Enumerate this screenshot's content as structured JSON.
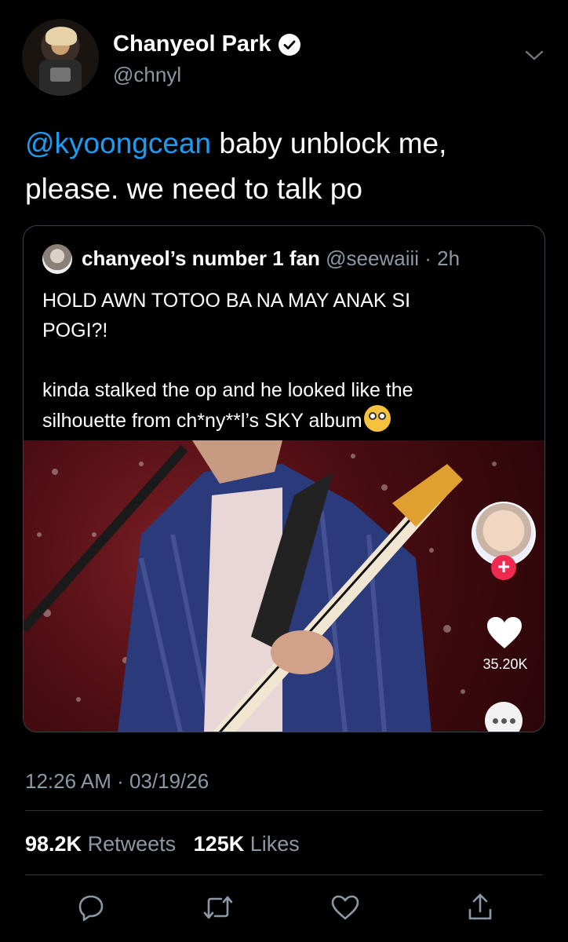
{
  "author": {
    "name": "Chanyeol Park",
    "handle": "@chnyl",
    "verified": true
  },
  "tweet": {
    "mention": "@kyoongcean",
    "text_line1_rest": " baby unblock me,",
    "text_line2": "please. we need to talk po"
  },
  "quote": {
    "name": "chanyeol’s number 1 fan",
    "handle": "@seewaiii",
    "sep": " · ",
    "age": "2h",
    "text_line1": "HOLD AWN TOTOO BA NA MAY ANAK SI",
    "text_line2": "POGI?!",
    "text_line3": "kinda stalked the op and he looked like the",
    "text_line4": "silhouette from ch*ny**l’s SKY album",
    "emoji": "flushed-face",
    "media": {
      "like_count": "35.20K"
    }
  },
  "timestamp": {
    "time": "12:26 AM",
    "sep": " · ",
    "date": "03/19/26"
  },
  "stats": {
    "retweets_count": "98.2K",
    "retweets_label": "Retweets",
    "likes_count": "125K",
    "likes_label": "Likes"
  },
  "actions": [
    "reply-icon",
    "retweet-icon",
    "like-icon",
    "share-icon"
  ],
  "colors": {
    "background": "#000000",
    "link": "#1d9bf0",
    "muted": "#8b98a5",
    "border": "#38444d"
  }
}
